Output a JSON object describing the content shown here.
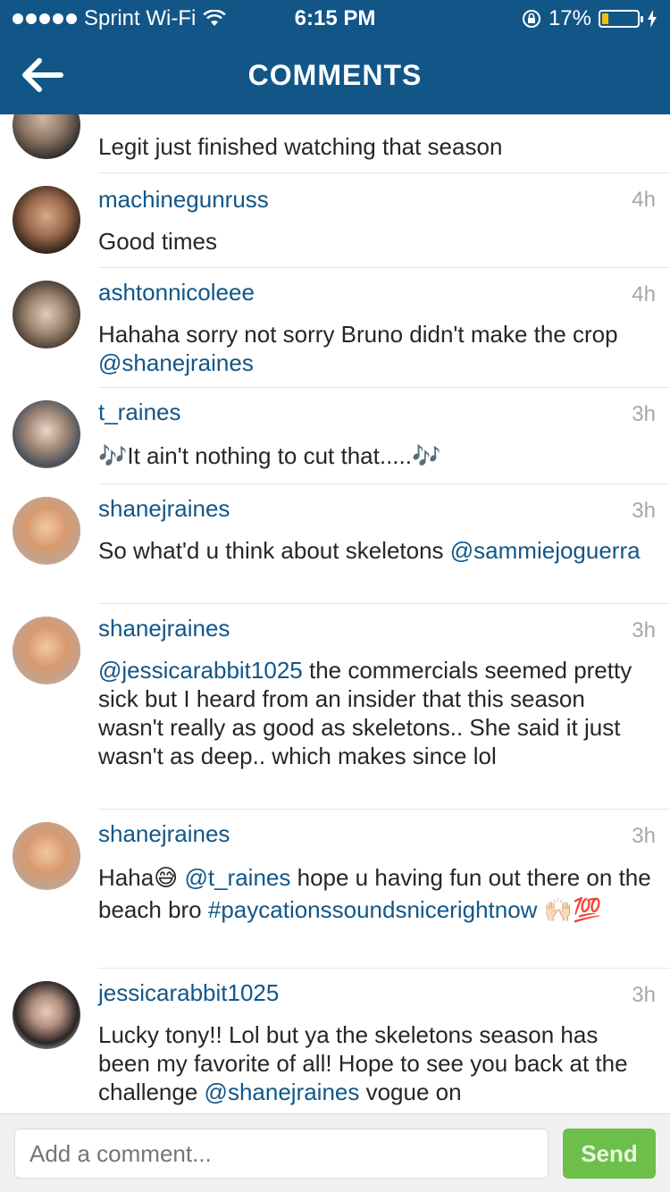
{
  "status_bar": {
    "carrier": "Sprint Wi-Fi",
    "time": "6:15 PM",
    "battery": "17%"
  },
  "nav": {
    "title": "COMMENTS"
  },
  "comments": [
    {
      "username": "",
      "time": "",
      "parts": [
        {
          "t": "Legit just finished watching that season",
          "k": "text"
        }
      ]
    },
    {
      "username": "machinegunruss",
      "time": "4h",
      "parts": [
        {
          "t": "Good times",
          "k": "text"
        }
      ]
    },
    {
      "username": "ashtonnicoleee",
      "time": "4h",
      "parts": [
        {
          "t": "Hahaha sorry not sorry Bruno didn't make the crop ",
          "k": "text"
        },
        {
          "t": "@shanejraines",
          "k": "mention"
        }
      ]
    },
    {
      "username": "t_raines",
      "time": "3h",
      "parts": [
        {
          "t": "🎶It ain't nothing to cut that.....🎶",
          "k": "text"
        }
      ]
    },
    {
      "username": "shanejraines",
      "time": "3h",
      "parts": [
        {
          "t": "So what'd u think about skeletons ",
          "k": "text"
        },
        {
          "t": "@sammiejoguerra",
          "k": "mention"
        }
      ]
    },
    {
      "username": "shanejraines",
      "time": "3h",
      "parts": [
        {
          "t": "@jessicarabbit1025",
          "k": "mention"
        },
        {
          "t": " the commercials seemed pretty sick but I heard from an insider that this season wasn't really as good as skeletons.. She said it just wasn't as deep.. which makes since lol",
          "k": "text"
        }
      ]
    },
    {
      "username": "shanejraines",
      "time": "3h",
      "parts": [
        {
          "t": "Haha😅 ",
          "k": "text"
        },
        {
          "t": "@t_raines",
          "k": "mention"
        },
        {
          "t": " hope u having fun out there on the beach bro ",
          "k": "text"
        },
        {
          "t": "#paycationssoundsnicerightnow",
          "k": "hashtag"
        },
        {
          "t": " 🙌🏻💯",
          "k": "text"
        }
      ]
    },
    {
      "username": "jessicarabbit1025",
      "time": "3h",
      "parts": [
        {
          "t": "Lucky tony!! Lol but ya the skeletons season has been my favorite of all! Hope to see you back at the challenge ",
          "k": "text"
        },
        {
          "t": "@shanejraines",
          "k": "mention"
        },
        {
          "t": " vogue on",
          "k": "text"
        }
      ]
    }
  ],
  "composer": {
    "placeholder": "Add a comment...",
    "send_label": "Send"
  }
}
